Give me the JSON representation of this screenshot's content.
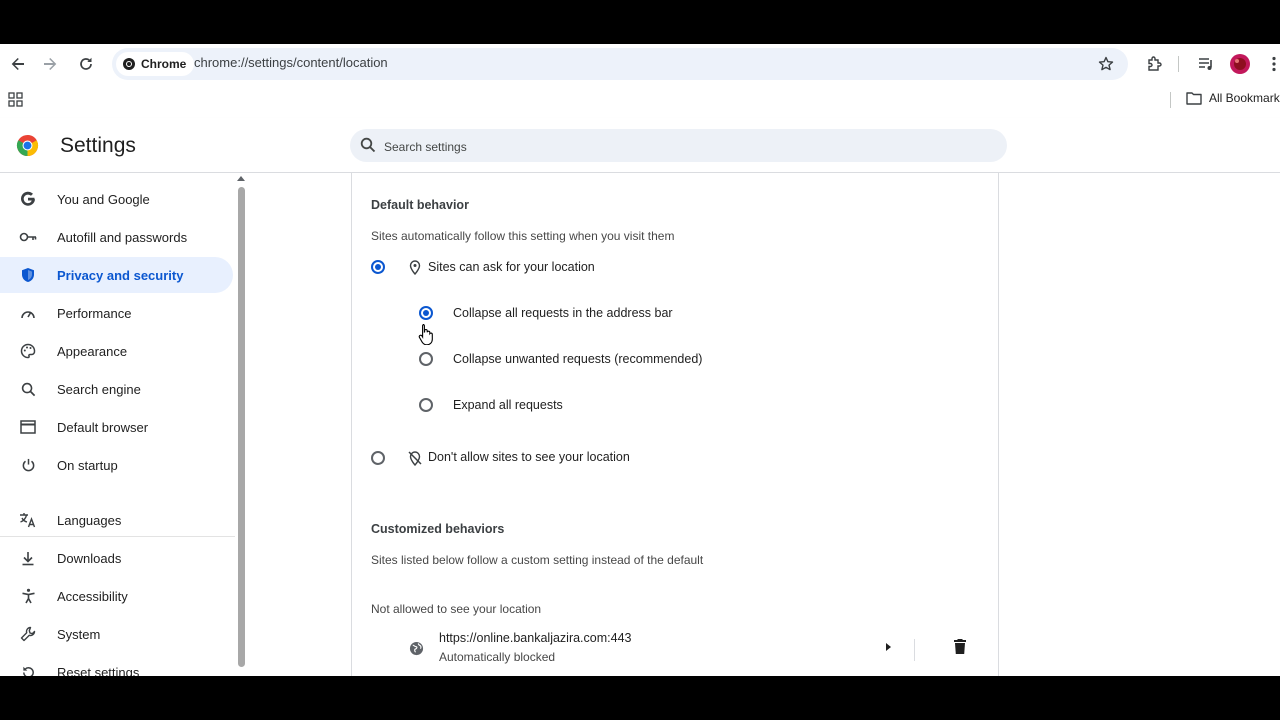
{
  "toolbar": {
    "chip_label": "Chrome",
    "url": "chrome://settings/content/location"
  },
  "bookmarks": {
    "all_bookmarks": "All Bookmarks"
  },
  "header": {
    "title": "Settings",
    "search_placeholder": "Search settings"
  },
  "sidebar": {
    "items": [
      {
        "label": "You and Google",
        "icon": "google-g-icon"
      },
      {
        "label": "Autofill and passwords",
        "icon": "key-icon"
      },
      {
        "label": "Privacy and security",
        "icon": "shield-icon",
        "active": true
      },
      {
        "label": "Performance",
        "icon": "gauge-icon"
      },
      {
        "label": "Appearance",
        "icon": "palette-icon"
      },
      {
        "label": "Search engine",
        "icon": "search-icon"
      },
      {
        "label": "Default browser",
        "icon": "browser-window-icon"
      },
      {
        "label": "On startup",
        "icon": "power-icon"
      },
      {
        "label": "Languages",
        "icon": "translate-icon"
      },
      {
        "label": "Downloads",
        "icon": "download-icon"
      },
      {
        "label": "Accessibility",
        "icon": "accessibility-icon"
      },
      {
        "label": "System",
        "icon": "wrench-icon"
      },
      {
        "label": "Reset settings",
        "icon": "reset-icon"
      }
    ]
  },
  "content": {
    "default_heading": "Default behavior",
    "default_desc": "Sites automatically follow this setting when you visit them",
    "option_ask": "Sites can ask for your location",
    "sub_collapse_all": "Collapse all requests in the address bar",
    "sub_collapse_unwanted": "Collapse unwanted requests (recommended)",
    "sub_expand_all": "Expand all requests",
    "option_block": "Don't allow sites to see your location",
    "custom_heading": "Customized behaviors",
    "custom_desc": "Sites listed below follow a custom setting instead of the default",
    "not_allowed_heading": "Not allowed to see your location",
    "sites": [
      {
        "url": "https://online.bankaljazira.com:443",
        "status": "Automatically blocked"
      }
    ]
  },
  "colors": {
    "accent": "#0b57d0",
    "active_bg": "#e8f0fe"
  }
}
